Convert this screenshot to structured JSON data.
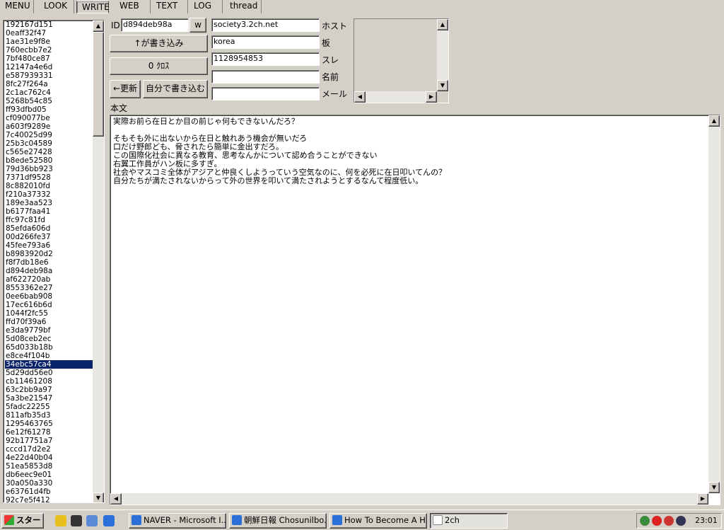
{
  "tabs": [
    "MENU",
    "LOOK",
    "WRITE",
    "WEB",
    "TEXT",
    "LOG",
    "thread"
  ],
  "active_tab": "WRITE",
  "id_list": {
    "items": [
      "192167d151",
      "0eaff32f47",
      "1ae31e9f8e",
      "760ecbb7e2",
      "7bf480ce87",
      "12147a4e6d",
      "e587939331",
      "8fc27f264a",
      "2c1ac762c4",
      "5268b54c85",
      "ff93dfbd05",
      "cf090077be",
      "a603f9289e",
      "7c40025d99",
      "25b3c04589",
      "c565e27428",
      "b8ede52580",
      "79d36bb923",
      "7371df9528",
      "8c882010fd",
      "f210a37332",
      "189e3aa523",
      "b6177faa41",
      "ffc97c81fd",
      "85efda606d",
      "00d266fe37",
      "45fee793a6",
      "b8983920d2",
      "f8f7db18e6",
      "d894deb98a",
      "af622720ab",
      "8553362e27",
      "0ee6bab908",
      "17ec616b6d",
      "1044f2fc55",
      "ffd70f39a6",
      "e3da9779bf",
      "5d08ceb2ec",
      "65d033b18b",
      "e8ce4f104b",
      "34ebc57ca4",
      "5d29dd56e0",
      "cb11461208",
      "63c2bb9a97",
      "5a3be21547",
      "5fadc22255",
      "811afb35d3",
      "1295463765",
      "6e12f61278",
      "92b17751a7",
      "cccd17d2e2",
      "4e22d40b04",
      "51ea5853d8",
      "db6eec9e01",
      "30a050a330",
      "e63761d4fb",
      "92c7e5f412"
    ],
    "selected_index": 40
  },
  "form": {
    "id_label": "ID",
    "id_value": "d894deb98a",
    "w_button": "w",
    "post_up_button": "↑が書き込み",
    "zero_cross_button": "0 ｸﾛｽ",
    "refresh_button": "←更新",
    "self_post_button": "自分で書き込む",
    "host_value": "society3.2ch.net",
    "host_label": "ホスト",
    "board_value": "korea",
    "board_label": "板",
    "thread_value": "1128954853",
    "thread_label": "スレ",
    "name_value": "",
    "name_label": "名前",
    "mail_value": "",
    "mail_label": "メール",
    "body_label": "本文",
    "body_text": "実際お前ら在日とか目の前じゃ何もできないんだろ？\n\nそもそも外に出ないから在日と触れあう機会が無いだろ\n口だけ野郎ども、脅されたら簡単に金出すだろ。\nこの国際化社会に異なる教育、思考なんかについて認め合うことができない\n右翼工作員がハン板に多すぎ。\n社会やマスコミ全体がアジアと仲良くしようっていう空気なのに、何を必死に在日叩いてんの？\n自分たちが満たされないからって外の世界を叩いて満たされようとするなんて程度低い。"
  },
  "taskbar": {
    "start_label": "スタート",
    "windows": [
      {
        "title": "NAVER - Microsoft I..."
      },
      {
        "title": "朝鮮日報 Chosunilbo..."
      },
      {
        "title": "How To Become A H..."
      },
      {
        "title": "2ch"
      }
    ],
    "active_window": 3,
    "clock": "23:01"
  }
}
